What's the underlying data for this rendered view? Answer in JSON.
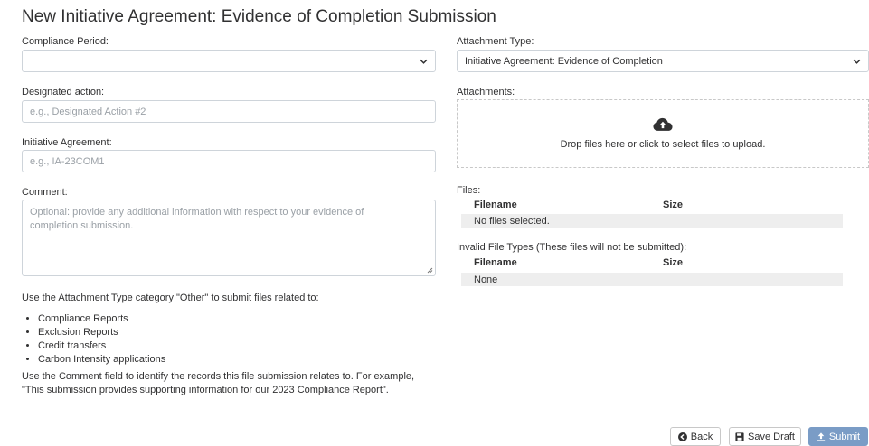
{
  "page": {
    "title": "New Initiative Agreement: Evidence of Completion Submission"
  },
  "form": {
    "compliance_period_label": "Compliance Period:",
    "compliance_period_value": "",
    "designated_action_label": "Designated action:",
    "designated_action_placeholder": "e.g., Designated Action #2",
    "initiative_agreement_label": "Initiative Agreement:",
    "initiative_agreement_placeholder": "e.g., IA-23COM1",
    "comment_label": "Comment:",
    "comment_placeholder": "Optional: provide any additional information with respect to your evidence of completion submission."
  },
  "help": {
    "intro": "Use the Attachment Type category \"Other\" to submit files related to:",
    "items": [
      "Compliance Reports",
      "Exclusion Reports",
      "Credit transfers",
      "Carbon Intensity applications"
    ],
    "comment_note": "Use the Comment field to identify the records this file submission relates to. For example, \"This submission provides supporting information for our 2023 Compliance Report\"."
  },
  "attachments": {
    "type_label": "Attachment Type:",
    "type_value": "Initiative Agreement: Evidence of Completion",
    "attachments_label": "Attachments:",
    "dropzone_text": "Drop files here or click to select files to upload.",
    "dropzone_icon": "cloud-upload-icon",
    "files_label": "Files:",
    "filename_header": "Filename",
    "size_header": "Size",
    "no_files": "No files selected.",
    "invalid_label": "Invalid File Types (These files will not be submitted):",
    "invalid_filename_header": "Filename",
    "invalid_size_header": "Size",
    "invalid_none": "None"
  },
  "actions": {
    "back": "Back",
    "save_draft": "Save Draft",
    "submit": "Submit"
  },
  "colors": {
    "primary_button": "#7a9cc6",
    "text": "#313132",
    "border": "#ced4da"
  }
}
